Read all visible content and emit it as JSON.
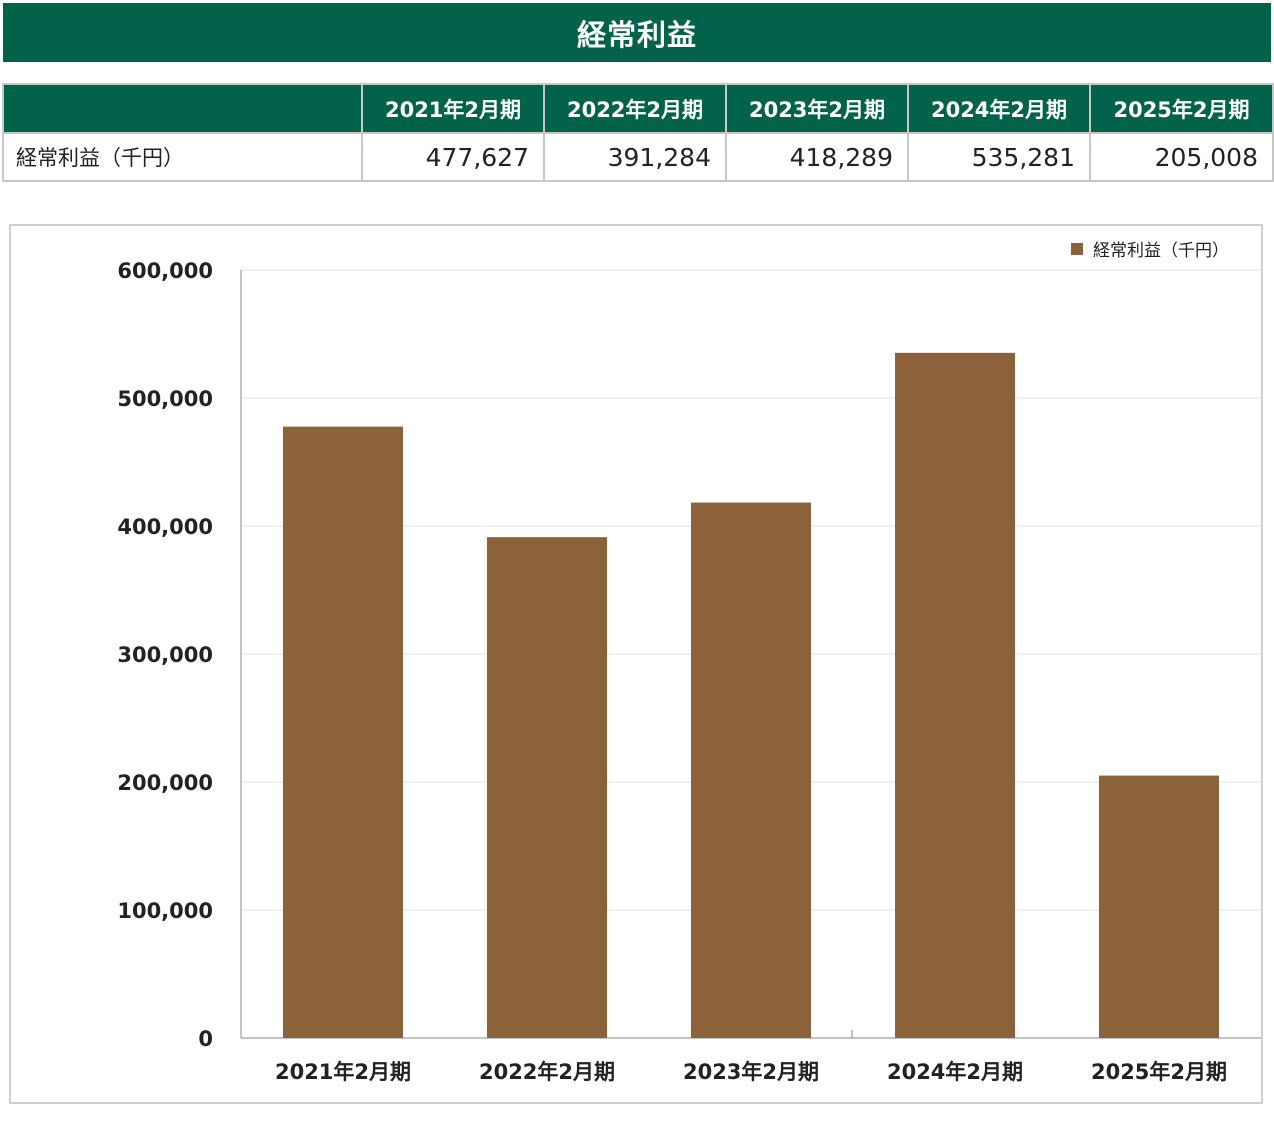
{
  "title": "経常利益",
  "table": {
    "corner": "",
    "headers": [
      "2021年2月期",
      "2022年2月期",
      "2023年2月期",
      "2024年2月期",
      "2025年2月期"
    ],
    "row_label": "経常利益（千円）",
    "values": [
      "477,627",
      "391,284",
      "418,289",
      "535,281",
      "205,008"
    ]
  },
  "chart_data": {
    "type": "bar",
    "categories": [
      "2021年2月期",
      "2022年2月期",
      "2023年2月期",
      "2024年2月期",
      "2025年2月期"
    ],
    "series": [
      {
        "name": "経常利益（千円）",
        "values": [
          477627,
          391284,
          418289,
          535281,
          205008
        ],
        "color": "#8b6239"
      }
    ],
    "ylim": [
      0,
      600000
    ],
    "yticks": [
      0,
      100000,
      200000,
      300000,
      400000,
      500000,
      600000
    ],
    "ytick_labels": [
      "0",
      "100,000",
      "200,000",
      "300,000",
      "400,000",
      "500,000",
      "600,000"
    ],
    "grid": true,
    "legend_position": "top-right",
    "xlabel": "",
    "ylabel": ""
  },
  "colors": {
    "header_green": "#02624a",
    "bar_brown": "#8b6239",
    "border_gray": "#c7c7c7"
  }
}
